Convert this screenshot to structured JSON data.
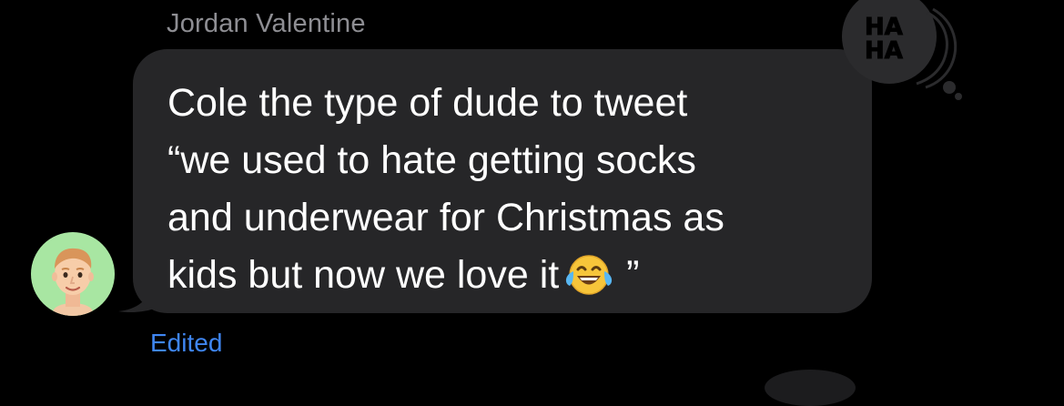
{
  "message": {
    "sender_name": "Jordan Valentine",
    "text": "Cole the type of dude to tweet\n“we used to hate getting socks\nand underwear for Christmas as\nkids but now we love it",
    "emoji": "face-with-tears-of-joy",
    "closing_quote": "”",
    "edited_label": "Edited"
  },
  "tapback": {
    "reaction": "haha",
    "line1": "HA",
    "line2": "HA"
  },
  "colors": {
    "background": "#000000",
    "bubble": "#262628",
    "sender_name": "#8e8e93",
    "edited_label": "#3f86f2",
    "avatar_bg": "#a8e6a2",
    "tapback_bg": "#2b2b2d"
  }
}
